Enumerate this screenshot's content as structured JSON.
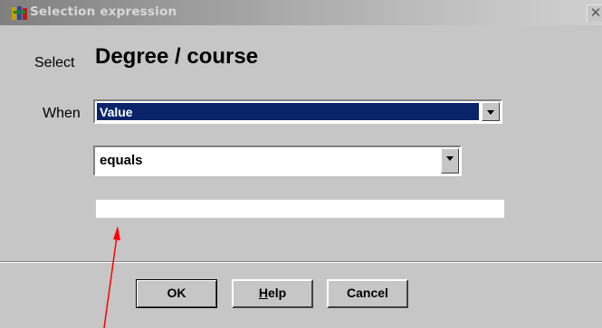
{
  "window": {
    "title": "Selection expression",
    "close_glyph": "✕"
  },
  "form": {
    "select_label": "Select",
    "field_name": "Degree / course",
    "when_label": "When",
    "when_value": "Value",
    "operator_value": "equals",
    "value_input": ""
  },
  "buttons": {
    "ok": "OK",
    "help_underline": "H",
    "help_rest": "elp",
    "cancel": "Cancel"
  },
  "colors": {
    "dialog_bg": "#c6c6c6",
    "selection": "#0a246a",
    "annotation_arrow": "#ff0000"
  },
  "icons": [
    "app-icon",
    "close-icon",
    "dropdown-arrow-icon"
  ]
}
